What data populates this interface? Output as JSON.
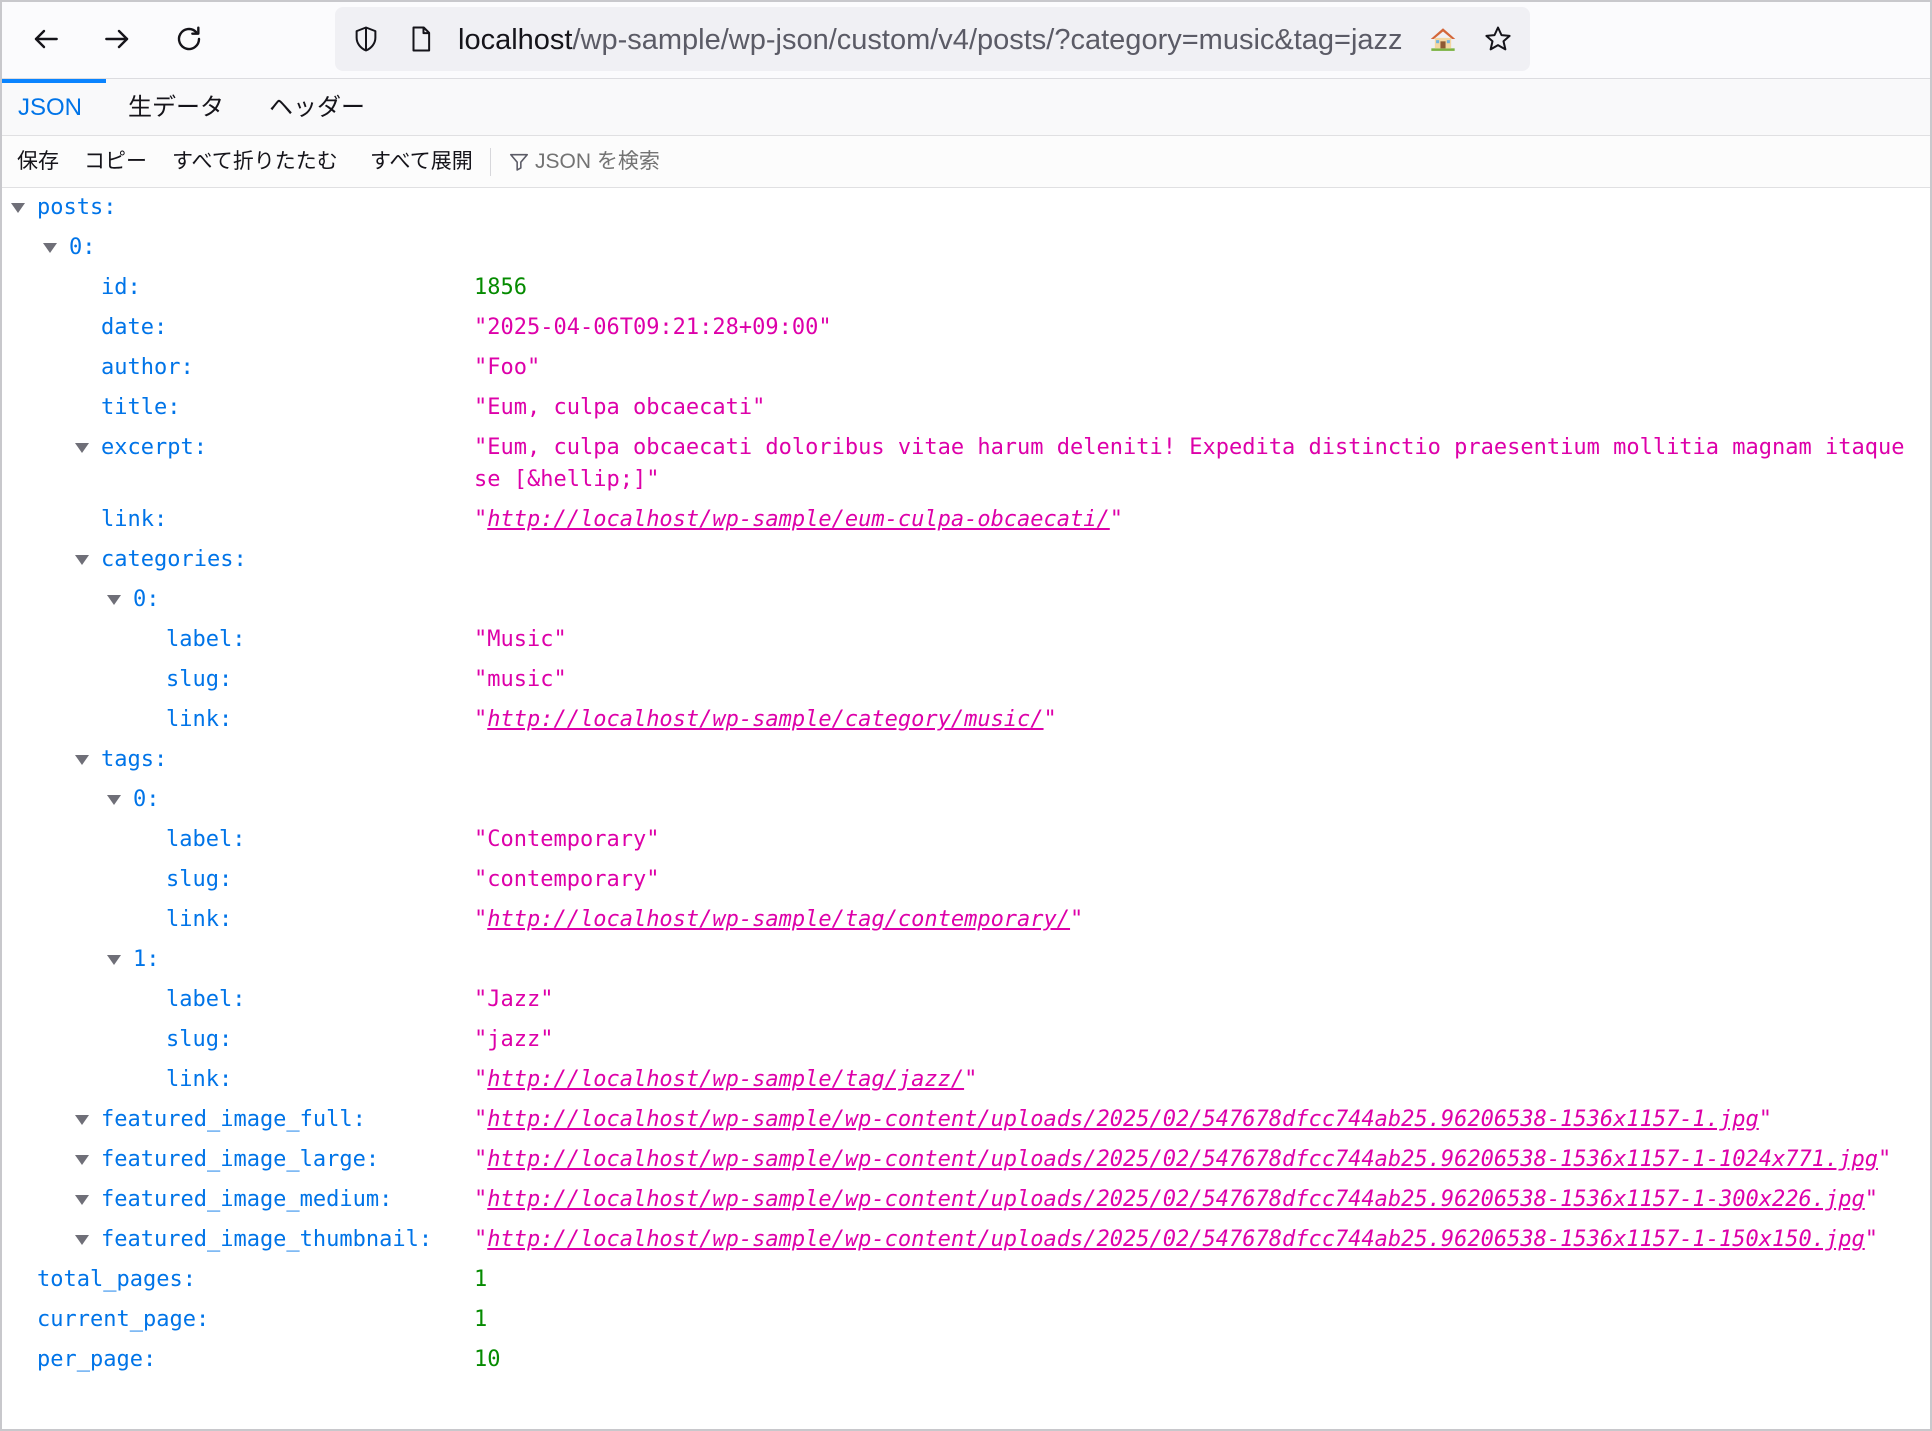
{
  "browser": {
    "url": {
      "host": "localhost",
      "path": "/wp-sample/wp-json/custom/v4/posts/?category=music&tag=jazz"
    },
    "nav_icons": [
      "back-arrow-icon",
      "forward-arrow-icon",
      "reload-icon"
    ],
    "urlbar_icons": [
      "shield-icon",
      "page-icon",
      "home-icon",
      "star-icon"
    ]
  },
  "viewer": {
    "tabs": [
      {
        "label": "JSON",
        "selected": true
      },
      {
        "label": "生データ",
        "selected": false
      },
      {
        "label": "ヘッダー",
        "selected": false
      }
    ],
    "toolbar": {
      "save": "保存",
      "copy": "コピー",
      "collapse_all": "すべて折りたたむ",
      "expand_all": "すべて展開",
      "filter_icon": "filter-icon",
      "filter_placeholder": "JSON を検索"
    }
  },
  "json_tree": {
    "rows": [
      {
        "key": "posts",
        "expanded": true
      },
      {
        "key": "0",
        "expanded": true
      },
      {
        "key": "id",
        "value": 1856
      },
      {
        "key": "date",
        "value": "2025-04-06T09:21:28+09:00"
      },
      {
        "key": "author",
        "value": "Foo"
      },
      {
        "key": "title",
        "value": "Eum, culpa obcaecati"
      },
      {
        "key": "excerpt",
        "value": "Eum, culpa obcaecati doloribus vitae harum deleniti! Expedita distinctio praesentium mollitia magnam itaque se [&hellip;]",
        "expanded": true
      },
      {
        "key": "link",
        "value": "http://localhost/wp-sample/eum-culpa-obcaecati/"
      },
      {
        "key": "categories",
        "expanded": true
      },
      {
        "key": "0",
        "expanded": true
      },
      {
        "key": "label",
        "value": "Music"
      },
      {
        "key": "slug",
        "value": "music"
      },
      {
        "key": "link",
        "value": "http://localhost/wp-sample/category/music/"
      },
      {
        "key": "tags",
        "expanded": true
      },
      {
        "key": "0",
        "expanded": true
      },
      {
        "key": "label",
        "value": "Contemporary"
      },
      {
        "key": "slug",
        "value": "contemporary"
      },
      {
        "key": "link",
        "value": "http://localhost/wp-sample/tag/contemporary/"
      },
      {
        "key": "1",
        "expanded": true
      },
      {
        "key": "label",
        "value": "Jazz"
      },
      {
        "key": "slug",
        "value": "jazz"
      },
      {
        "key": "link",
        "value": "http://localhost/wp-sample/tag/jazz/"
      },
      {
        "key": "featured_image_full",
        "value": "http://localhost/wp-sample/wp-content/uploads/2025/02/547678dfcc744ab25.96206538-1536x1157-1.jpg",
        "expanded": true
      },
      {
        "key": "featured_image_large",
        "value": "http://localhost/wp-sample/wp-content/uploads/2025/02/547678dfcc744ab25.96206538-1536x1157-1-1024x771.jpg",
        "expanded": true
      },
      {
        "key": "featured_image_medium",
        "value": "http://localhost/wp-sample/wp-content/uploads/2025/02/547678dfcc744ab25.96206538-1536x1157-1-300x226.jpg",
        "expanded": true
      },
      {
        "key": "featured_image_thumbnail",
        "value": "http://localhost/wp-sample/wp-content/uploads/2025/02/547678dfcc744ab25.96206538-1536x1157-1-150x150.jpg",
        "expanded": true
      },
      {
        "key": "total_pages",
        "value": 1
      },
      {
        "key": "current_page",
        "value": 1
      },
      {
        "key": "per_page",
        "value": 10
      }
    ]
  },
  "colors": {
    "key": "#0074e8",
    "string": "#dd00a9",
    "number": "#058b00",
    "selected_tab_indicator": "#0a84ff",
    "urlbar_background": "#f0f0f4"
  }
}
